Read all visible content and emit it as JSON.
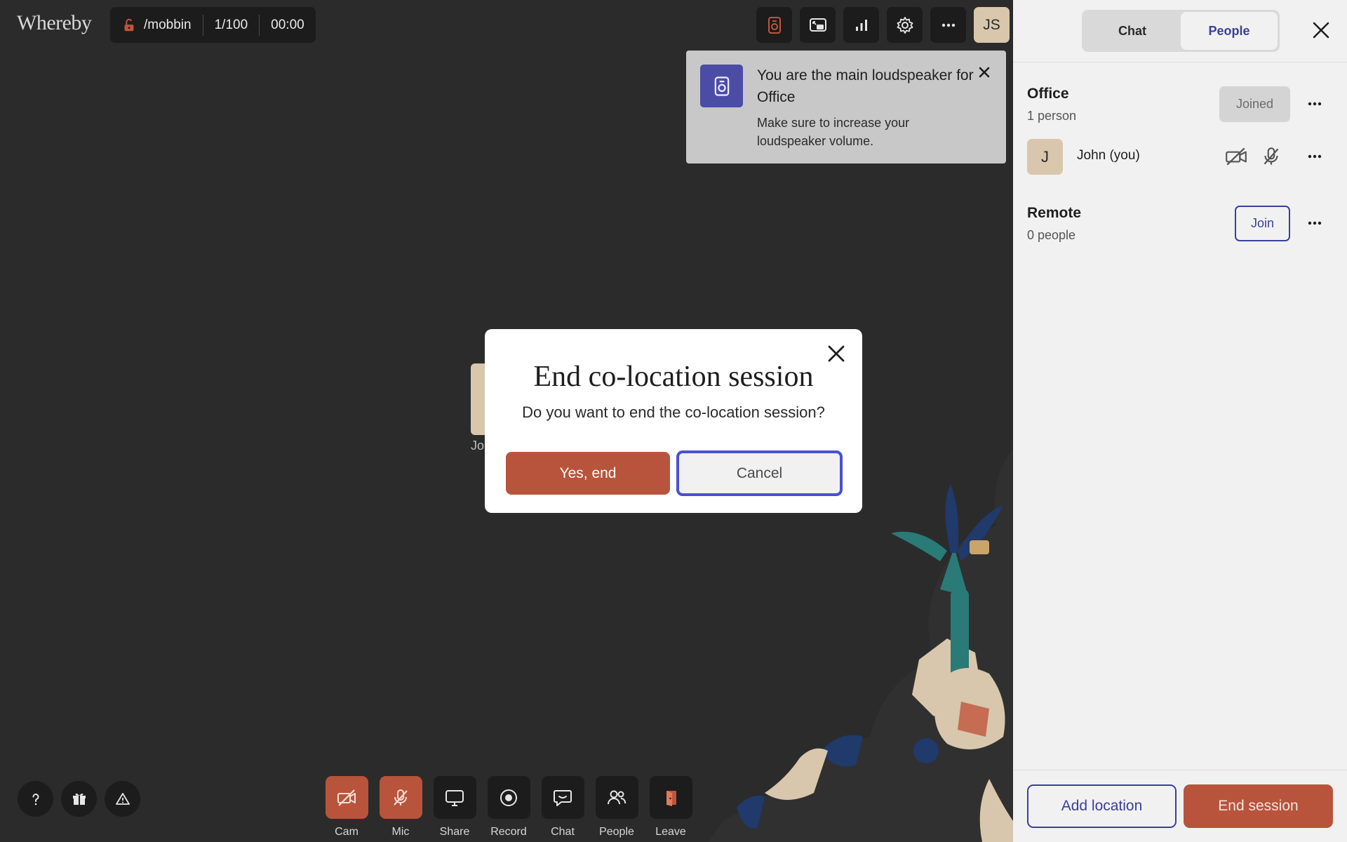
{
  "app": {
    "logo_text": "Whereby"
  },
  "room": {
    "name": "/mobbin",
    "capacity": "1/100",
    "timer": "00:00"
  },
  "top_toolbar": {
    "icons": [
      "loudspeaker-icon",
      "picture-in-picture-icon",
      "stats-bars-icon",
      "gear-icon",
      "more-dots-icon"
    ],
    "user_initials": "JS"
  },
  "toast": {
    "title": "You are the main loudspeaker for Office",
    "body": "Make sure to increase your loudspeaker volume."
  },
  "tile": {
    "name_partial": "Jo"
  },
  "dialog": {
    "title": "End co-location session",
    "text": "Do you want to end the co-location session?",
    "confirm_label": "Yes, end",
    "cancel_label": "Cancel"
  },
  "bottom_bar": {
    "items": [
      {
        "label": "Cam",
        "icon": "camera-off-icon",
        "state": "off"
      },
      {
        "label": "Mic",
        "icon": "mic-off-icon",
        "state": "off"
      },
      {
        "label": "Share",
        "icon": "screen-share-icon"
      },
      {
        "label": "Record",
        "icon": "record-icon"
      },
      {
        "label": "Chat",
        "icon": "chat-bubble-icon"
      },
      {
        "label": "People",
        "icon": "people-icon"
      },
      {
        "label": "Leave",
        "icon": "leave-door-icon"
      }
    ]
  },
  "corner_buttons": [
    "help-icon",
    "gift-icon",
    "warning-icon"
  ],
  "panel": {
    "tabs": [
      {
        "label": "Chat",
        "active": false
      },
      {
        "label": "People",
        "active": true
      }
    ],
    "groups": [
      {
        "title": "Office",
        "count": "1 person",
        "action": "Joined"
      },
      {
        "title": "Remote",
        "count": "0 people",
        "action": "Join"
      }
    ],
    "member": {
      "initial": "J",
      "name": "John (you)"
    },
    "footer": {
      "add_location": "Add location",
      "end_session": "End session"
    }
  },
  "colors": {
    "accent": "#3b3f98",
    "danger": "#b8543b",
    "stage_bg": "#2b2b2b",
    "panel_bg": "#f1f1f1",
    "avatar_bg": "#d8c7ac"
  }
}
